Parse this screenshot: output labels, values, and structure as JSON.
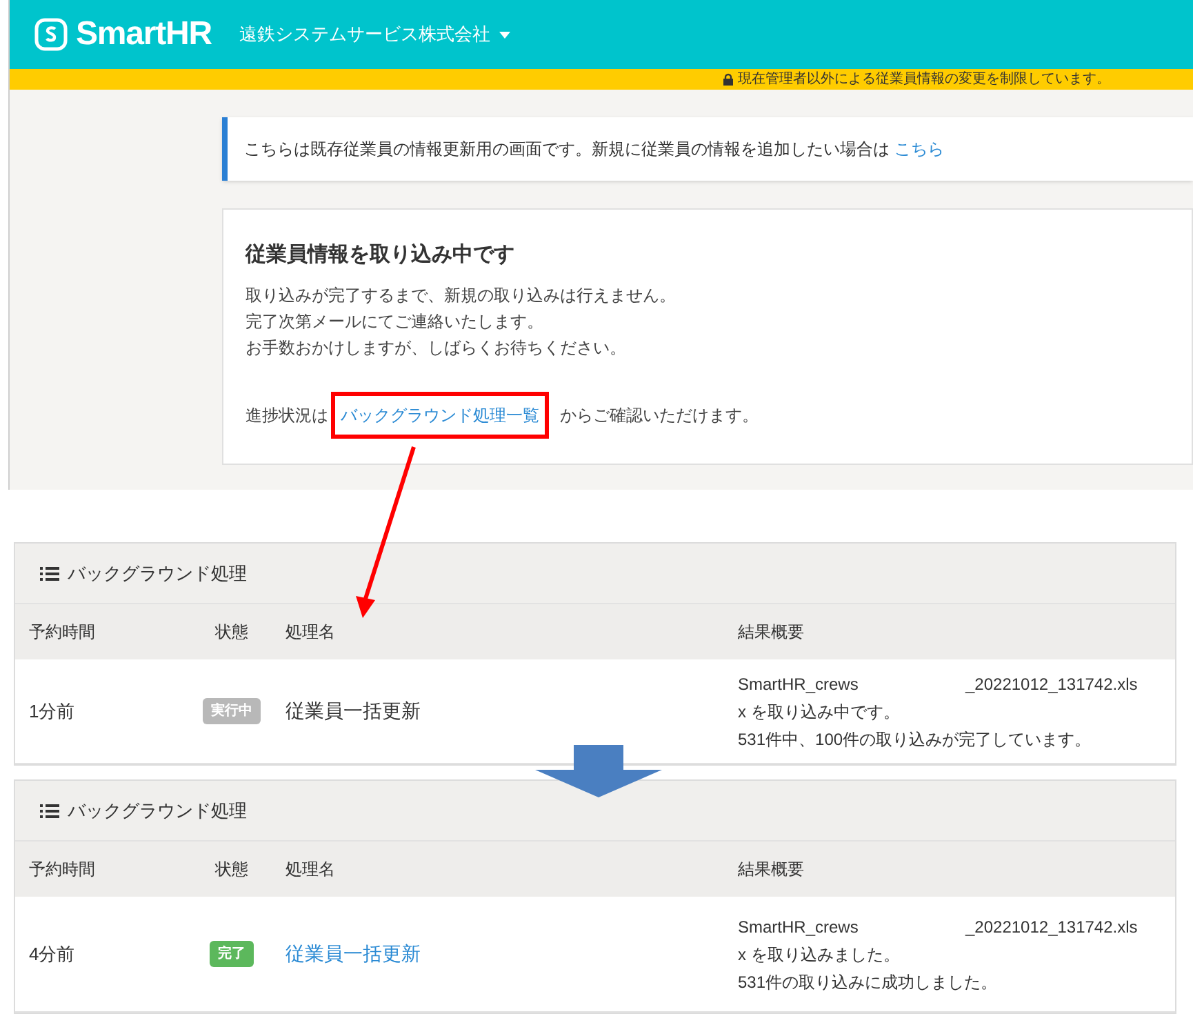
{
  "header": {
    "logo": "SmartHR",
    "company": "遠鉄システムサービス株式会社"
  },
  "restriction_bar": {
    "text": "現在管理者以外による従業員情報の変更を制限しています。"
  },
  "notice": {
    "text": "こちらは既存従業員の情報更新用の画面です。新規に従業員の情報を追加したい場合は",
    "link": "こちら"
  },
  "import_card": {
    "title": "従業員情報を取り込み中です",
    "lines": [
      "取り込みが完了するまで、新規の取り込みは行えません。",
      "完了次第メールにてご連絡いたします。",
      "お手数おかけしますが、しばらくお待ちください。"
    ],
    "progress_prefix": "進捗状況は",
    "progress_link": "バックグラウンド処理一覧",
    "progress_suffix": "からご確認いただけます。"
  },
  "job_panels": [
    {
      "title": "バックグラウンド処理",
      "columns": [
        "予約時間",
        "状態",
        "処理名",
        "結果概要"
      ],
      "rows": [
        {
          "time": "1分前",
          "status": {
            "label": "実行中",
            "kind": "running"
          },
          "name": "従業員一括更新",
          "name_link": false,
          "file_start": "SmartHR_crews",
          "file_end": "_20221012_131742.xls",
          "summary_lines": [
            "x を取り込み中です。",
            "531件中、100件の取り込みが完了しています。"
          ]
        }
      ]
    },
    {
      "title": "バックグラウンド処理",
      "columns": [
        "予約時間",
        "状態",
        "処理名",
        "結果概要"
      ],
      "rows": [
        {
          "time": "4分前",
          "status": {
            "label": "完了",
            "kind": "done"
          },
          "name": "従業員一括更新",
          "name_link": true,
          "file_start": "SmartHR_crews",
          "file_end": "_20221012_131742.xls",
          "summary_lines": [
            "x を取り込みました。",
            "531件の取り込みに成功しました。"
          ]
        }
      ]
    }
  ]
}
